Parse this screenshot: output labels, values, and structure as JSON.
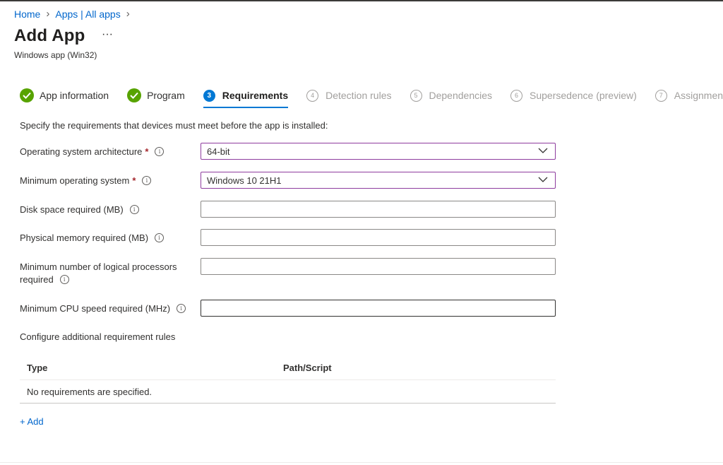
{
  "breadcrumb": {
    "home": "Home",
    "apps": "Apps | All apps"
  },
  "header": {
    "title": "Add App",
    "more": "···",
    "subtitle": "Windows app (Win32)"
  },
  "steps": [
    {
      "label": "App information",
      "state": "complete"
    },
    {
      "label": "Program",
      "state": "complete"
    },
    {
      "number": "3",
      "label": "Requirements",
      "state": "active"
    },
    {
      "number": "4",
      "label": "Detection rules",
      "state": "pending"
    },
    {
      "number": "5",
      "label": "Dependencies",
      "state": "pending"
    },
    {
      "number": "6",
      "label": "Supersedence (preview)",
      "state": "pending"
    },
    {
      "number": "7",
      "label": "Assignments",
      "state": "pending"
    }
  ],
  "form": {
    "intro": "Specify the requirements that devices must meet before the app is installed:",
    "os_arch": {
      "label": "Operating system architecture",
      "value": "64-bit"
    },
    "min_os": {
      "label": "Minimum operating system",
      "value": "Windows 10 21H1"
    },
    "disk": {
      "label": "Disk space required (MB)",
      "value": ""
    },
    "memory": {
      "label": "Physical memory required (MB)",
      "value": ""
    },
    "processors": {
      "label_line1": "Minimum number of logical processors",
      "label_line2": "required",
      "value": ""
    },
    "cpu": {
      "label": "Minimum CPU speed required (MHz)",
      "value": ""
    }
  },
  "rules": {
    "title": "Configure additional requirement rules",
    "columns": [
      "Type",
      "Path/Script"
    ],
    "empty": "No requirements are specified.",
    "add": "+ Add"
  },
  "colors": {
    "accent": "#0078d4",
    "success": "#57a300",
    "required": "#a4262c",
    "link": "#0066cc"
  }
}
